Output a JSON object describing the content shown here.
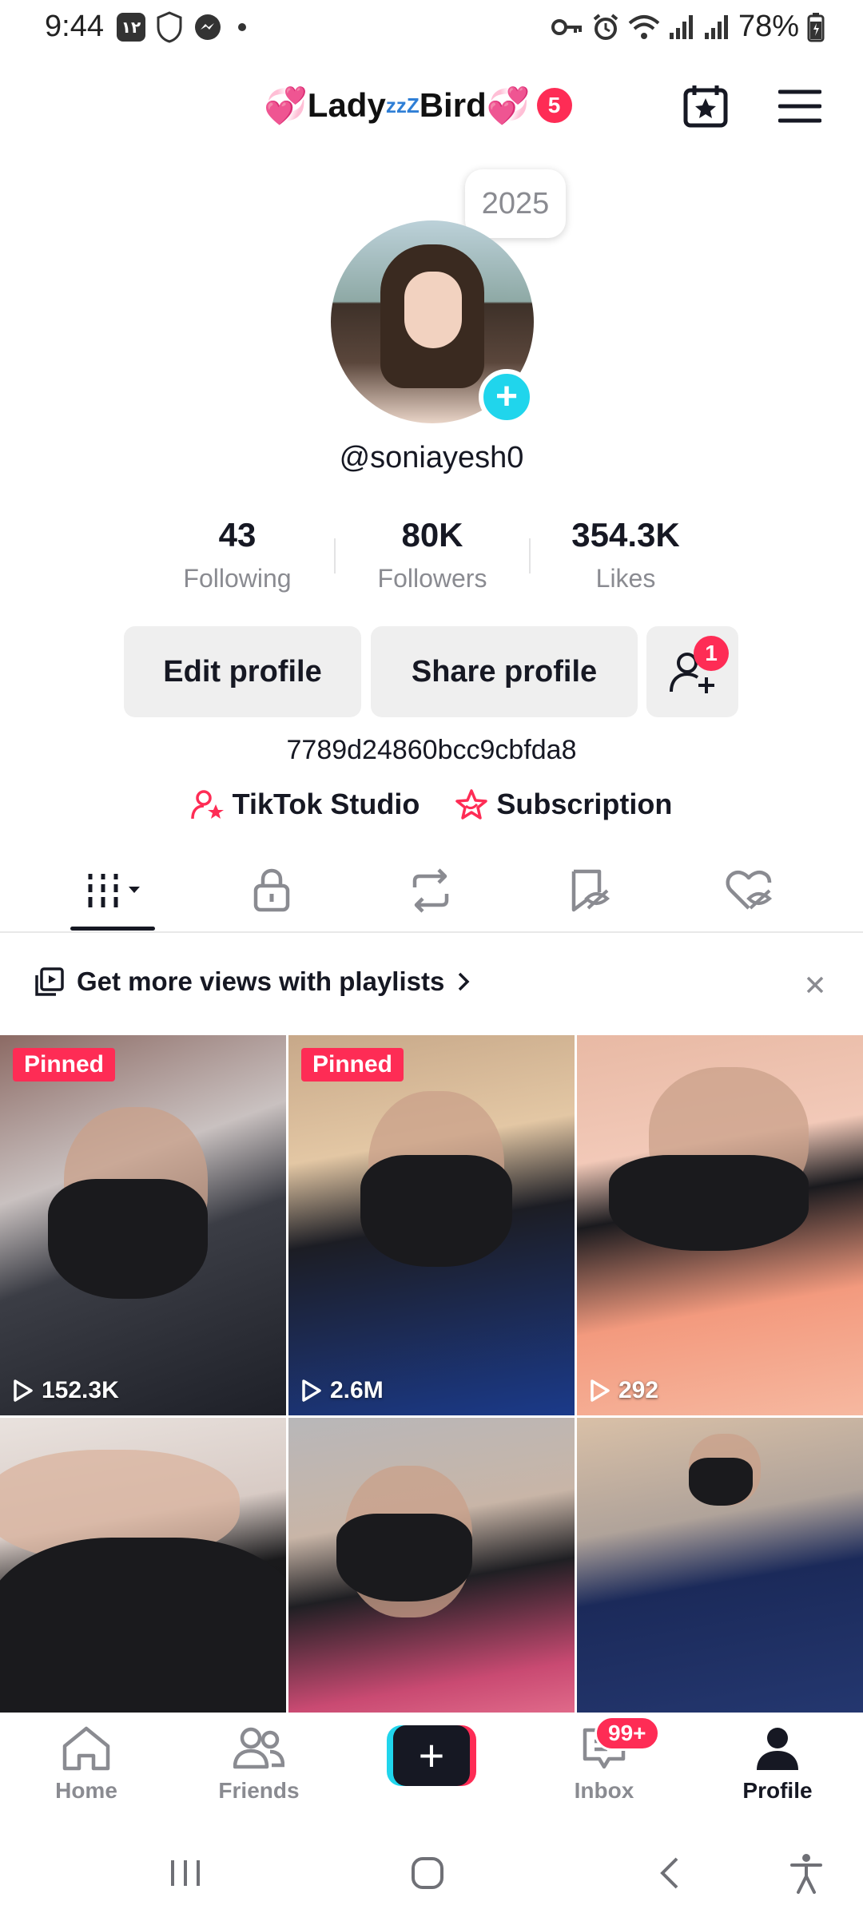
{
  "status_bar": {
    "time": "9:44",
    "badge_text": "۱۲",
    "battery_percent": "78%"
  },
  "header": {
    "username_display": "Lady",
    "zzz": "zzZ",
    "name_suffix": "Bird",
    "notification_count": "5"
  },
  "profile": {
    "year_bubble": "2025",
    "handle": "@soniayesh0",
    "stats": [
      {
        "value": "43",
        "label": "Following"
      },
      {
        "value": "80K",
        "label": "Followers"
      },
      {
        "value": "354.3K",
        "label": "Likes"
      }
    ],
    "edit_label": "Edit profile",
    "share_label": "Share profile",
    "add_friend_badge": "1",
    "bio": "7789d24860bcc9cbfda8",
    "studio_label": "TikTok Studio",
    "subscription_label": "Subscription"
  },
  "playlist_banner": {
    "text": "Get more views with playlists"
  },
  "videos": [
    {
      "pinned": "Pinned",
      "views": "152.3K"
    },
    {
      "pinned": "Pinned",
      "views": "2.6M"
    },
    {
      "views": "292"
    }
  ],
  "bottom_nav": {
    "home": "Home",
    "friends": "Friends",
    "inbox": "Inbox",
    "inbox_badge": "99+",
    "profile": "Profile"
  },
  "colors": {
    "accent_red": "#fe2c55",
    "accent_cyan": "#20d5ec",
    "text_primary": "#161823",
    "text_secondary": "#8a8b91"
  }
}
